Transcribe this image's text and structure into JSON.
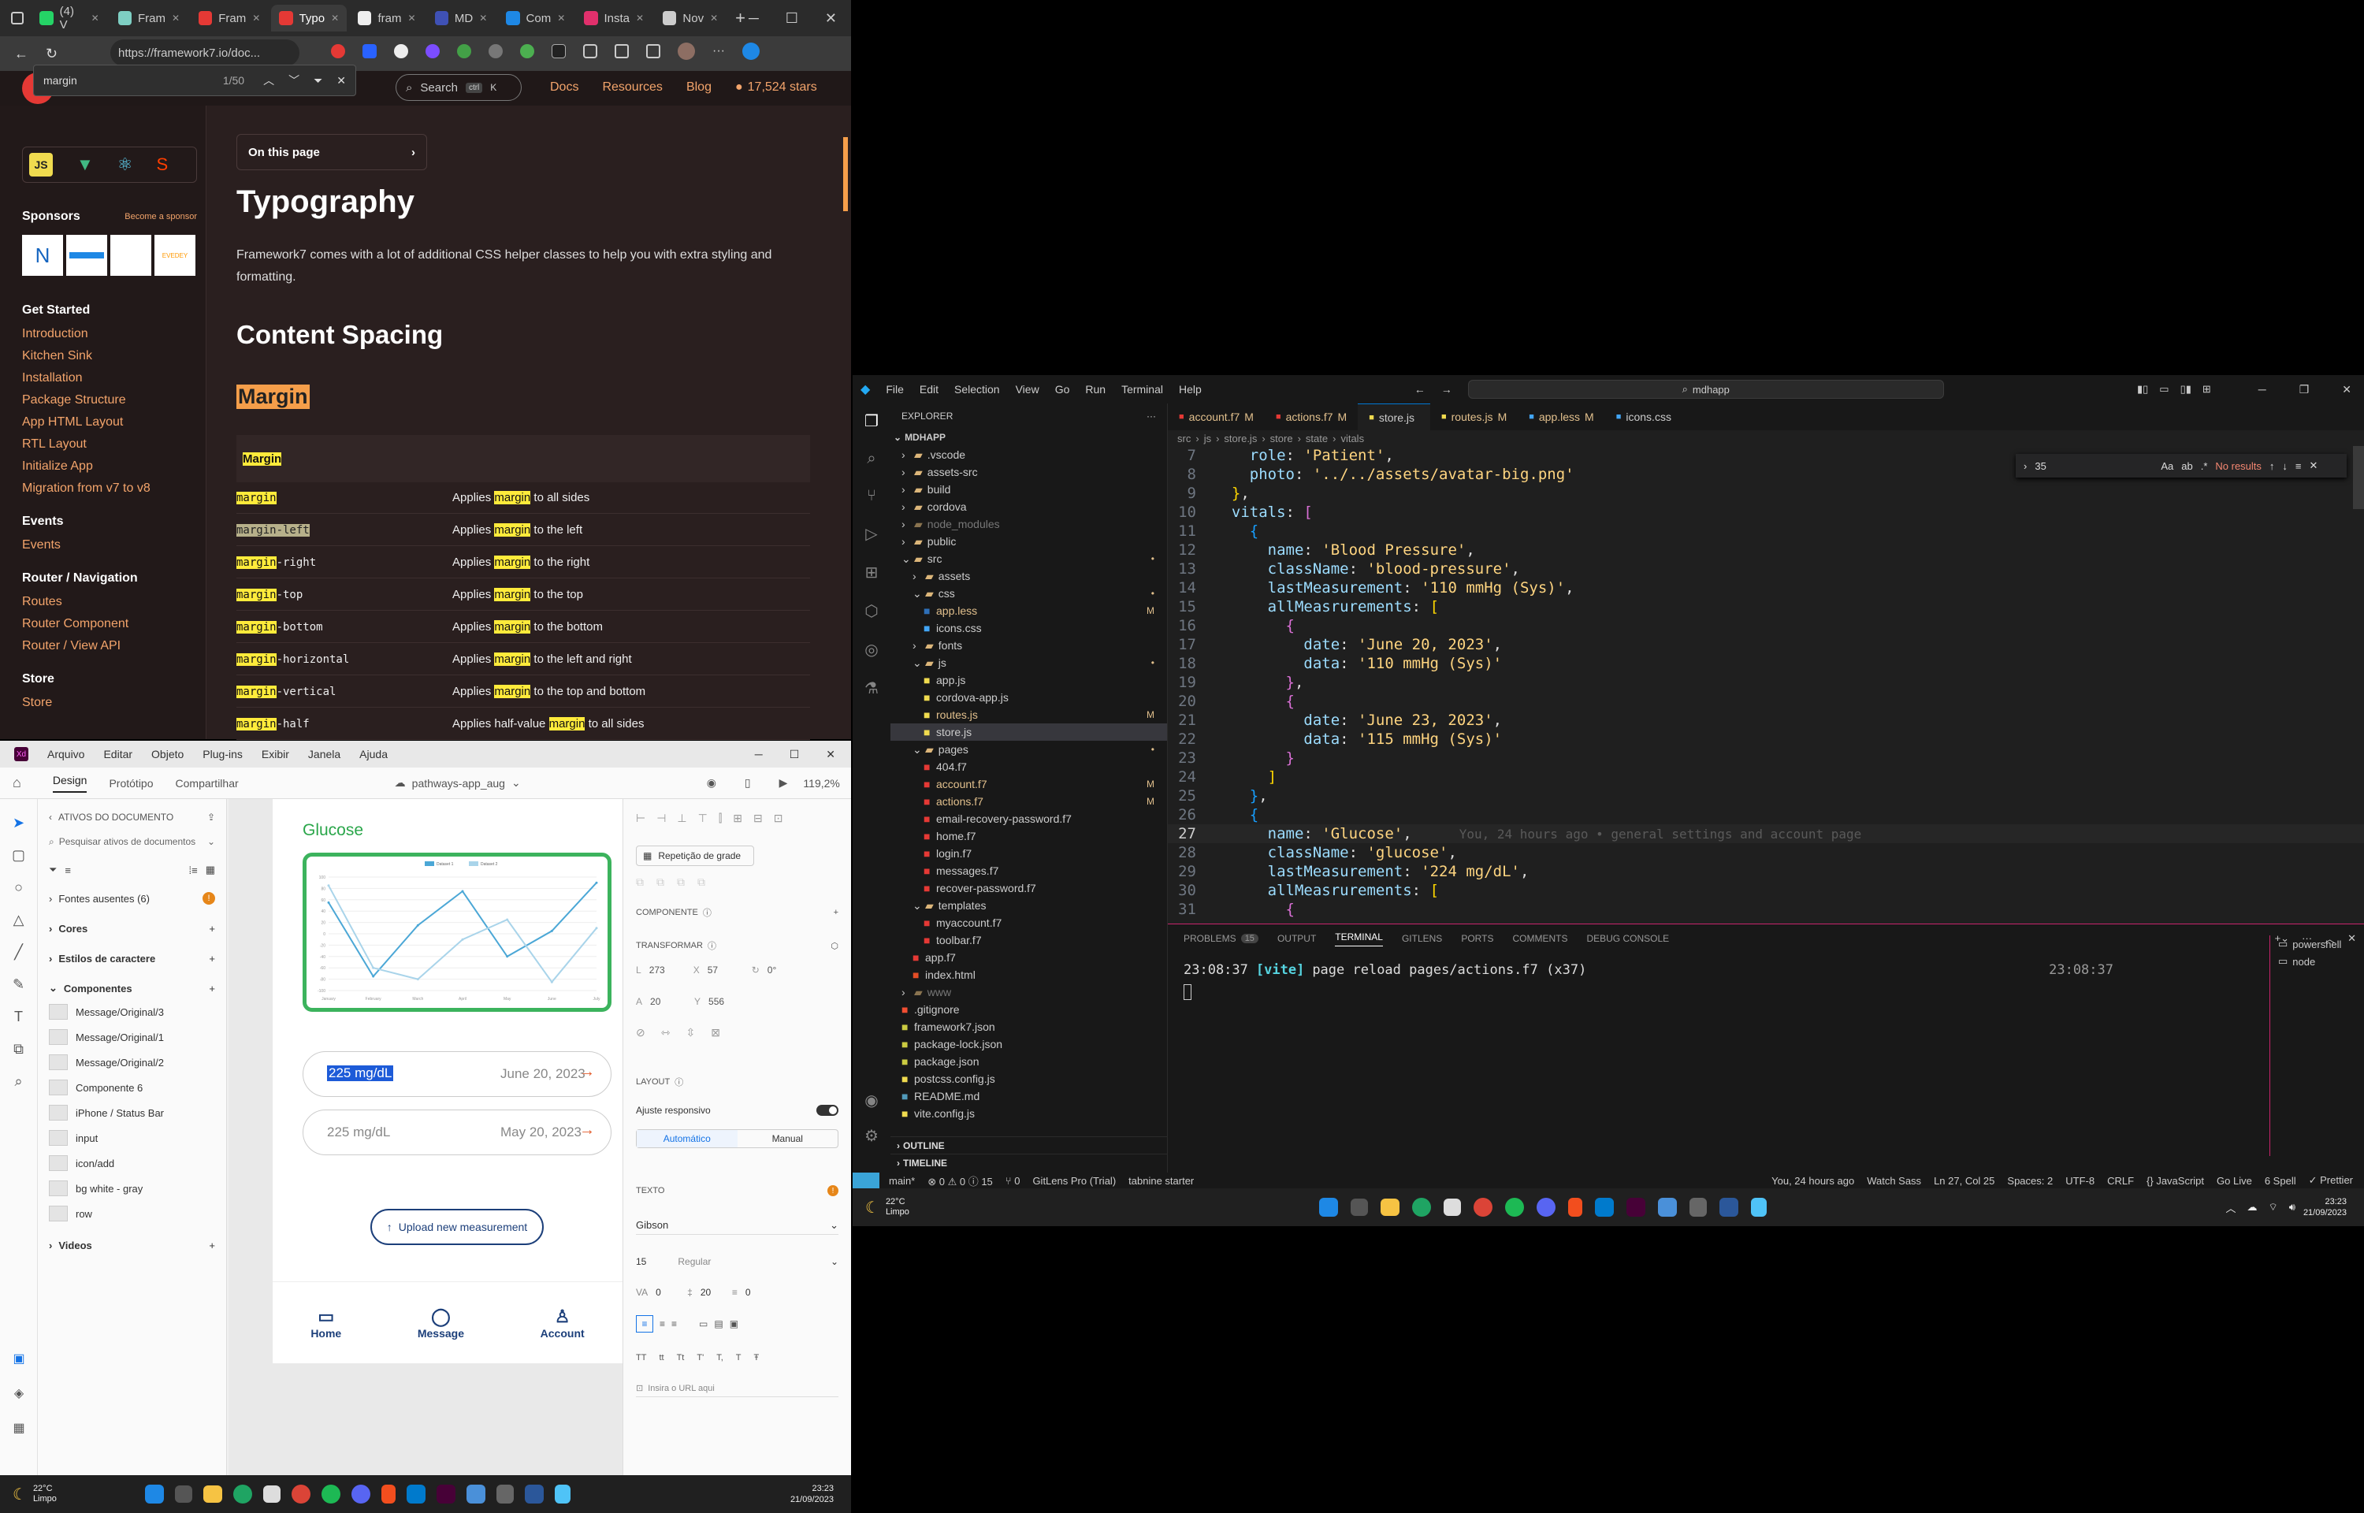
{
  "browser": {
    "tabs": [
      {
        "label": "(4) V",
        "color": "#25d366"
      },
      {
        "label": "Fram",
        "color": "#7ecfc3"
      },
      {
        "label": "Fram",
        "color": "#e53935"
      },
      {
        "label": "Typo",
        "color": "#e53935"
      },
      {
        "label": "fram",
        "color": "#eeeeee"
      },
      {
        "label": "MD",
        "color": "#3f51b5"
      },
      {
        "label": "Com",
        "color": "#1e88e5"
      },
      {
        "label": "Insta",
        "color": "#e1306c"
      },
      {
        "label": "Nov",
        "color": "#cccccc"
      }
    ],
    "url": "https://framework7.io/doc...",
    "find": {
      "query": "margin",
      "count": "1/50"
    },
    "header": {
      "search": "Search",
      "kbd1": "ctrl",
      "kbd2": "K",
      "links": [
        "Docs",
        "Resources",
        "Blog"
      ],
      "stars": "17,524 stars"
    },
    "sidebar": {
      "sponsors": "Sponsors",
      "become": "Become a sponsor",
      "sponsor_logos": [
        "N",
        "",
        "",
        "EVEDEY"
      ],
      "sections": [
        {
          "title": "Get Started",
          "items": [
            "Introduction",
            "Kitchen Sink",
            "Installation",
            "Package Structure",
            "App HTML Layout",
            "RTL Layout",
            "Initialize App",
            "Migration from v7 to v8"
          ]
        },
        {
          "title": "Events",
          "items": [
            "Events"
          ]
        },
        {
          "title": "Router / Navigation",
          "items": [
            "Routes",
            "Router Component",
            "Router / View API"
          ]
        },
        {
          "title": "Store",
          "items": [
            "Store"
          ]
        }
      ]
    },
    "content": {
      "on_this_page": "On this page",
      "title": "Typography",
      "intro": "Framework7 comes with a lot of additional CSS helper classes to help you with extra styling and formatting.",
      "h2": "Content Spacing",
      "h3": "Margin",
      "table_head": "Margin",
      "rows": [
        {
          "cls_hl": "margin",
          "cls_rest": "",
          "pre": "Applies ",
          "hl": "margin",
          "post": " to all sides"
        },
        {
          "cls_hl": "margin",
          "cls_rest": "-left",
          "pre": "Applies ",
          "hl": "margin",
          "post": " to the left"
        },
        {
          "cls_hl": "margin",
          "cls_rest": "-right",
          "pre": "Applies ",
          "hl": "margin",
          "post": " to the right"
        },
        {
          "cls_hl": "margin",
          "cls_rest": "-top",
          "pre": "Applies ",
          "hl": "margin",
          "post": " to the top"
        },
        {
          "cls_hl": "margin",
          "cls_rest": "-bottom",
          "pre": "Applies ",
          "hl": "margin",
          "post": " to the bottom"
        },
        {
          "cls_hl": "margin",
          "cls_rest": "-horizontal",
          "pre": "Applies ",
          "hl": "margin",
          "post": " to the left and right"
        },
        {
          "cls_hl": "margin",
          "cls_rest": "-vertical",
          "pre": "Applies ",
          "hl": "margin",
          "post": " to the top and bottom"
        },
        {
          "cls_hl": "margin",
          "cls_rest": "-half",
          "pre": "Applies half-value ",
          "hl": "margin",
          "post": " to all sides"
        }
      ]
    }
  },
  "xd": {
    "menu": [
      "Arquivo",
      "Editar",
      "Objeto",
      "Plug-ins",
      "Exibir",
      "Janela",
      "Ajuda"
    ],
    "modes": [
      "Design",
      "Protótipo",
      "Compartilhar"
    ],
    "doc": "pathways-app_aug",
    "zoom": "119,2%",
    "assets_title": "ATIVOS DO DOCUMENTO",
    "search_placeholder": "Pesquisar ativos de documentos",
    "missing_fonts": "Fontes ausentes (6)",
    "missing_count": "!",
    "groups": [
      "Cores",
      "Estilos de caractere",
      "Componentes"
    ],
    "components": [
      "Message/Original/3",
      "Message/Original/1",
      "Message/Original/2",
      "Componente 6",
      "iPhone / Status Bar",
      "input",
      "icon/add",
      "bg white - gray",
      "row"
    ],
    "videos": "Videos",
    "artboard": {
      "heading": "Glucose",
      "legend": [
        "Dataset 1",
        "Dataset 2"
      ],
      "months": [
        "January",
        "February",
        "March",
        "April",
        "May",
        "June",
        "July"
      ],
      "y_ticks": [
        "100",
        "80",
        "60",
        "40",
        "20",
        "0",
        "-20",
        "-40",
        "-60",
        "-80",
        "-100"
      ],
      "series": [
        {
          "name": "Dataset 1",
          "values": [
            55,
            -75,
            15,
            75,
            -40,
            5,
            90
          ],
          "color": "#4ba7d6"
        },
        {
          "name": "Dataset 2",
          "values": [
            85,
            -60,
            -80,
            -10,
            25,
            -85,
            10
          ],
          "color": "#a9d4ea"
        }
      ],
      "reading1": {
        "value": "225 mg/dL",
        "date": "June 20, 2023"
      },
      "reading2": {
        "value": "225 mg/dL",
        "date": "May 20, 2023"
      },
      "upload": "Upload new measurement",
      "nav": [
        "Home",
        "Message",
        "Account"
      ]
    },
    "props": {
      "repeat": "Repetição de grade",
      "components_title": "COMPONENTE",
      "transform_title": "TRANSFORMAR",
      "w": "273",
      "x": "57",
      "rot": "0°",
      "h": "20",
      "y": "556",
      "layout_title": "LAYOUT",
      "responsive": "Ajuste responsivo",
      "auto": "Automático",
      "manual": "Manual",
      "text_title": "TEXTO",
      "font": "Gibson",
      "size": "15",
      "weight": "Regular",
      "charspace": "0",
      "lineh": "20",
      "para": "0",
      "url_placeholder": "Insira o URL aqui"
    }
  },
  "vscode": {
    "menu": [
      "File",
      "Edit",
      "Selection",
      "View",
      "Go",
      "Run",
      "Terminal",
      "Help"
    ],
    "search": "mdhapp",
    "explorer_title": "EXPLORER",
    "project": "MDHAPP",
    "tree": [
      {
        "name": ".vscode",
        "depth": 1,
        "type": "folder",
        "badge": ""
      },
      {
        "name": "assets-src",
        "depth": 1,
        "type": "folder",
        "badge": ""
      },
      {
        "name": "build",
        "depth": 1,
        "type": "folder",
        "badge": ""
      },
      {
        "name": "cordova",
        "depth": 1,
        "type": "folder",
        "badge": ""
      },
      {
        "name": "node_modules",
        "depth": 1,
        "type": "folder-dim",
        "badge": ""
      },
      {
        "name": "public",
        "depth": 1,
        "type": "folder",
        "badge": ""
      },
      {
        "name": "src",
        "depth": 1,
        "type": "folder-open",
        "badge": "•"
      },
      {
        "name": "assets",
        "depth": 2,
        "type": "folder",
        "badge": ""
      },
      {
        "name": "css",
        "depth": 2,
        "type": "folder-open",
        "badge": "•"
      },
      {
        "name": "app.less",
        "depth": 3,
        "type": "less",
        "badge": "M"
      },
      {
        "name": "icons.css",
        "depth": 3,
        "type": "css",
        "badge": ""
      },
      {
        "name": "fonts",
        "depth": 2,
        "type": "folder",
        "badge": ""
      },
      {
        "name": "js",
        "depth": 2,
        "type": "folder-open",
        "badge": "•"
      },
      {
        "name": "app.js",
        "depth": 3,
        "type": "js",
        "badge": ""
      },
      {
        "name": "cordova-app.js",
        "depth": 3,
        "type": "js",
        "badge": ""
      },
      {
        "name": "routes.js",
        "depth": 3,
        "type": "js-mod",
        "badge": "M"
      },
      {
        "name": "store.js",
        "depth": 3,
        "type": "js-sel",
        "badge": ""
      },
      {
        "name": "pages",
        "depth": 2,
        "type": "folder-open",
        "badge": "•"
      },
      {
        "name": "404.f7",
        "depth": 3,
        "type": "f7",
        "badge": ""
      },
      {
        "name": "account.f7",
        "depth": 3,
        "type": "f7-mod",
        "badge": "M"
      },
      {
        "name": "actions.f7",
        "depth": 3,
        "type": "f7-mod",
        "badge": "M"
      },
      {
        "name": "email-recovery-password.f7",
        "depth": 3,
        "type": "f7",
        "badge": ""
      },
      {
        "name": "home.f7",
        "depth": 3,
        "type": "f7",
        "badge": ""
      },
      {
        "name": "login.f7",
        "depth": 3,
        "type": "f7",
        "badge": ""
      },
      {
        "name": "messages.f7",
        "depth": 3,
        "type": "f7",
        "badge": ""
      },
      {
        "name": "recover-password.f7",
        "depth": 3,
        "type": "f7",
        "badge": ""
      },
      {
        "name": "templates",
        "depth": 2,
        "type": "folder-open",
        "badge": ""
      },
      {
        "name": "myaccount.f7",
        "depth": 3,
        "type": "f7",
        "badge": ""
      },
      {
        "name": "toolbar.f7",
        "depth": 3,
        "type": "f7",
        "badge": ""
      },
      {
        "name": "app.f7",
        "depth": 2,
        "type": "f7",
        "badge": ""
      },
      {
        "name": "index.html",
        "depth": 2,
        "type": "html",
        "badge": ""
      },
      {
        "name": "www",
        "depth": 1,
        "type": "folder-dim",
        "badge": ""
      },
      {
        "name": ".gitignore",
        "depth": 1,
        "type": "git",
        "badge": ""
      },
      {
        "name": "framework7.json",
        "depth": 1,
        "type": "json",
        "badge": ""
      },
      {
        "name": "package-lock.json",
        "depth": 1,
        "type": "json",
        "badge": ""
      },
      {
        "name": "package.json",
        "depth": 1,
        "type": "json",
        "badge": ""
      },
      {
        "name": "postcss.config.js",
        "depth": 1,
        "type": "js",
        "badge": ""
      },
      {
        "name": "README.md",
        "depth": 1,
        "type": "md",
        "badge": ""
      },
      {
        "name": "vite.config.js",
        "depth": 1,
        "type": "js",
        "badge": ""
      }
    ],
    "outline": "OUTLINE",
    "timeline": "TIMELINE",
    "tabs": [
      {
        "label": "account.f7",
        "mod": "M"
      },
      {
        "label": "actions.f7",
        "mod": "M"
      },
      {
        "label": "store.js",
        "mod": ""
      },
      {
        "label": "routes.js",
        "mod": "M"
      },
      {
        "label": "app.less",
        "mod": "M"
      },
      {
        "label": "icons.css",
        "mod": ""
      }
    ],
    "breadcrumb": [
      "src",
      "js",
      "store.js",
      "store",
      "state",
      "vitals"
    ],
    "find": {
      "query": "35",
      "result": "No results"
    },
    "blame": "You, 24 hours ago • general settings and account page",
    "panel_tabs": [
      "PROBLEMS",
      "OUTPUT",
      "TERMINAL",
      "GITLENS",
      "PORTS",
      "COMMENTS",
      "DEBUG CONSOLE"
    ],
    "problems_count": "15",
    "terminal": {
      "time": "23:08:37",
      "tag": "[vite]",
      "msg": "page reload pages/actions.f7 (x37)"
    },
    "shells": [
      "powershell",
      "node"
    ],
    "status_left": [
      "main*",
      "⊗ 0 ⚠ 0 ⓘ 15",
      "⑂ 0",
      "GitLens Pro (Trial)",
      "tabnine starter"
    ],
    "status_right": [
      "You, 24 hours ago",
      "Watch Sass",
      "Ln 27, Col 25",
      "Spaces: 2",
      "UTF-8",
      "CRLF",
      "{} JavaScript",
      "Go Live",
      "6 Spell",
      "✓ Prettier"
    ]
  },
  "taskbar": {
    "weather_temp": "22°C",
    "weather_desc": "Limpo",
    "time": "23:23",
    "date": "21/09/2023"
  }
}
